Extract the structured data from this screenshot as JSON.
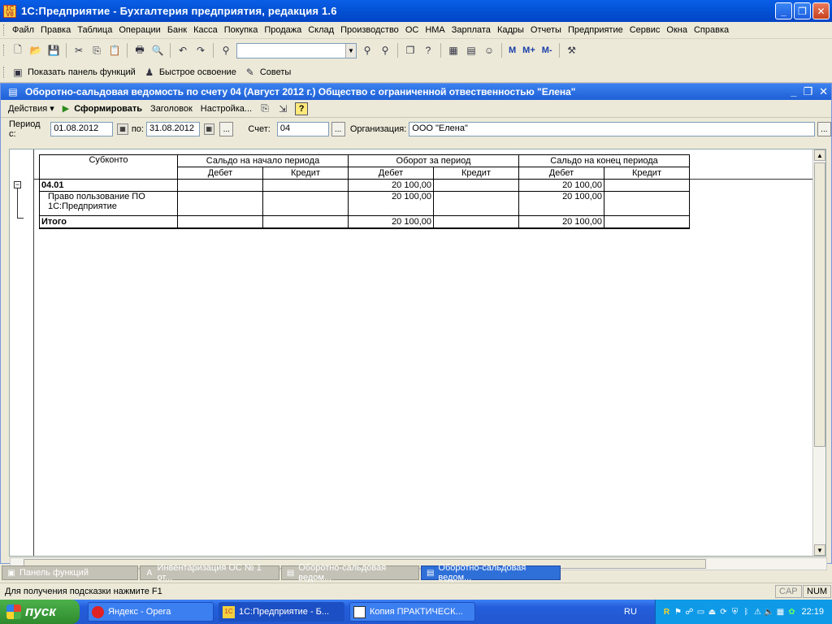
{
  "window": {
    "app_title": "1С:Предприятие - Бухгалтерия предприятия, редакция 1.6",
    "app_icon_text": "1C V8"
  },
  "menu": [
    "Файл",
    "Правка",
    "Таблица",
    "Операции",
    "Банк",
    "Касса",
    "Покупка",
    "Продажа",
    "Склад",
    "Производство",
    "ОС",
    "НМА",
    "Зарплата",
    "Кадры",
    "Отчеты",
    "Предприятие",
    "Сервис",
    "Окна",
    "Справка"
  ],
  "toolbar2": {
    "show_panel": "Показать панель функций",
    "quick_learn": "Быстрое освоение",
    "tips": "Советы",
    "m": "M",
    "mplus": "M+",
    "mminus": "M-"
  },
  "document": {
    "title": "Оборотно-сальдовая ведомость по счету 04 (Август 2012 г.) Общество с ограниченной отвественностью \"Елена\"",
    "actions": "Действия",
    "generate": "Сформировать",
    "header": "Заголовок",
    "settings": "Настройка..."
  },
  "filters": {
    "period_label": "Период с:",
    "period_from": "01.08.2012",
    "to_label": "по:",
    "period_to": "31.08.2012",
    "account_label": "Счет:",
    "account": "04",
    "org_label": "Организация:",
    "org": "ООО \"Елена\""
  },
  "report": {
    "headers": {
      "subkonto": "Субконто",
      "open_balance": "Сальдо на начало периода",
      "turnover": "Оборот за период",
      "close_balance": "Сальдо на конец периода",
      "debit": "Дебет",
      "credit": "Кредит"
    },
    "rows": [
      {
        "name": "04.01",
        "open_debit": "",
        "open_credit": "",
        "turn_debit": "20 100,00",
        "turn_credit": "",
        "close_debit": "20 100,00",
        "close_credit": ""
      },
      {
        "name": "Право пользование ПО 1С:Предприятие",
        "open_debit": "",
        "open_credit": "",
        "turn_debit": "20 100,00",
        "turn_credit": "",
        "close_debit": "20 100,00",
        "close_credit": ""
      },
      {
        "name": "Итого",
        "open_debit": "",
        "open_credit": "",
        "turn_debit": "20 100,00",
        "turn_credit": "",
        "close_debit": "20 100,00",
        "close_credit": ""
      }
    ]
  },
  "window_tabs": [
    "Панель функций",
    "Инвентаризация ОС № 1 от...",
    "Оборотно-сальдовая ведом...",
    "Оборотно-сальдовая ведом..."
  ],
  "status": {
    "hint": "Для получения подсказки нажмите F1",
    "cap": "CAP",
    "num": "NUM"
  },
  "taskbar": {
    "start": "пуск",
    "tasks": [
      "Яндекс - Opera",
      "1С:Предприятие - Б...",
      "Копия ПРАКТИЧЕСК..."
    ],
    "lang": "RU",
    "clock": "22:19"
  }
}
